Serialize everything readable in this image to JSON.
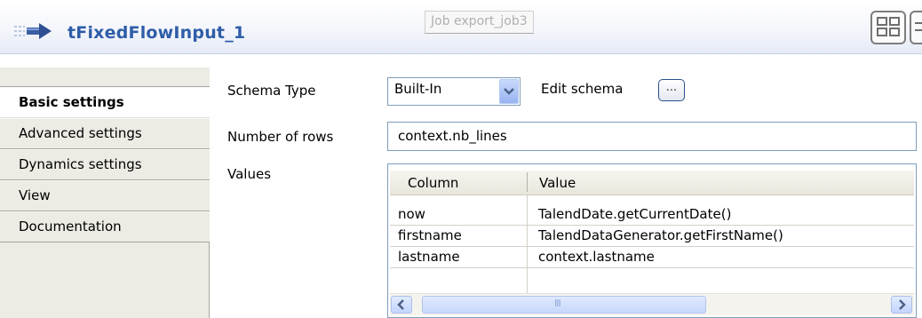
{
  "header": {
    "title": "tFixedFlowInput_1",
    "tooltip": "Job export_job3",
    "icons": [
      "flow-arrow-icon",
      "grid-view-icon",
      "list-view-icon"
    ]
  },
  "sidebar": {
    "tabs": [
      {
        "label": "Basic settings",
        "active": true
      },
      {
        "label": "Advanced settings",
        "active": false
      },
      {
        "label": "Dynamics settings",
        "active": false
      },
      {
        "label": "View",
        "active": false
      },
      {
        "label": "Documentation",
        "active": false
      }
    ]
  },
  "form": {
    "schema_type_label": "Schema Type",
    "schema_type_value": "Built-In",
    "edit_schema_label": "Edit schema",
    "edit_schema_button": "...",
    "rows_label": "Number of rows",
    "rows_value": "context.nb_lines",
    "values_label": "Values"
  },
  "table": {
    "columns": [
      "Column",
      "Value"
    ],
    "rows": [
      {
        "column": "now",
        "value": "TalendDate.getCurrentDate()"
      },
      {
        "column": "firstname",
        "value": "TalendDataGenerator.getFirstName()"
      },
      {
        "column": "lastname",
        "value": "context.lastname"
      }
    ],
    "scrollbar": {
      "thumb_grip": "III"
    }
  },
  "colors": {
    "title": "#2f5da8",
    "sidebar_bg": "#ecebe4",
    "input_border": "#7f9db9"
  }
}
